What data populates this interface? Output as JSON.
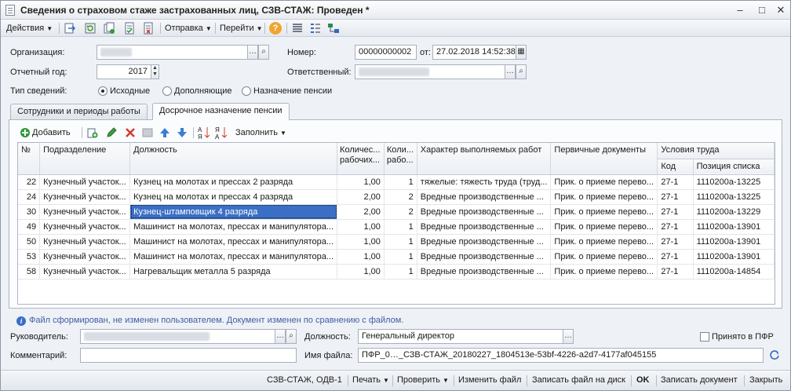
{
  "window": {
    "title": "Сведения о страховом стаже застрахованных лиц, СЗВ-СТАЖ: Проведен *",
    "minimize": "–",
    "maximize": "□",
    "close": "✕"
  },
  "toolbar": {
    "actions_label": "Действия",
    "send_label": "Отправка",
    "goto_label": "Перейти",
    "help_label": "?"
  },
  "form": {
    "organization_label": "Организация:",
    "organization_value": "",
    "number_label": "Номер:",
    "number_value": "00000000002",
    "date_label": "от:",
    "date_value": "27.02.2018 14:52:38",
    "year_label": "Отчетный год:",
    "year_value": "2017",
    "responsible_label": "Ответственный:",
    "responsible_value": "",
    "type_label": "Тип сведений:",
    "type_options": [
      "Исходные",
      "Дополняющие",
      "Назначение пенсии"
    ],
    "type_selected": "Исходные"
  },
  "tabs": [
    {
      "label": "Сотрудники и периоды работы"
    },
    {
      "label": "Досрочное назначение пенсии"
    }
  ],
  "grid_toolbar": {
    "add_label": "Добавить",
    "fill_label": "Заполнить"
  },
  "table": {
    "headers": {
      "num": "№",
      "dept": "Подразделение",
      "position": "Должность",
      "workers": "Количес... рабочих...",
      "places": "Коли... рабо...",
      "nature": "Характер выполняемых работ",
      "docs": "Первичные документы",
      "conditions": "Условия труда",
      "code": "Код",
      "list_pos": "Позиция списка"
    },
    "rows": [
      {
        "num": "22",
        "dept": "Кузнечный участок...",
        "position": "Кузнец на молотах и прессах 2 разряда",
        "workers": "1,00",
        "places": "1",
        "nature": "тяжелые: тяжесть труда (труд...",
        "docs": "Прик. о приеме перево...",
        "code": "27-1",
        "list_pos": "1110200а-13225"
      },
      {
        "num": "24",
        "dept": "Кузнечный участок...",
        "position": "Кузнец на молотах и прессах 4 разряда",
        "workers": "2,00",
        "places": "2",
        "nature": "Вредные производственные ...",
        "docs": "Прик. о приеме перево...",
        "code": "27-1",
        "list_pos": "1110200а-13225"
      },
      {
        "num": "30",
        "dept": "Кузнечный участок...",
        "position": "Кузнец-штамповщик 4 разряда",
        "workers": "2,00",
        "places": "2",
        "nature": "Вредные производственные ...",
        "docs": "Прик. о приеме перево...",
        "code": "27-1",
        "list_pos": "1110200а-13229"
      },
      {
        "num": "49",
        "dept": "Кузнечный участок...",
        "position": "Машинист на молотах, прессах и манипулятора...",
        "workers": "1,00",
        "places": "1",
        "nature": "Вредные производственные ...",
        "docs": "Прик. о приеме перево...",
        "code": "27-1",
        "list_pos": "1110200а-13901"
      },
      {
        "num": "50",
        "dept": "Кузнечный участок...",
        "position": "Машинист на молотах, прессах и манипулятора...",
        "workers": "1,00",
        "places": "1",
        "nature": "Вредные производственные ...",
        "docs": "Прик. о приеме перево...",
        "code": "27-1",
        "list_pos": "1110200а-13901"
      },
      {
        "num": "53",
        "dept": "Кузнечный участок...",
        "position": "Машинист на молотах, прессах и манипулятора...",
        "workers": "1,00",
        "places": "1",
        "nature": "Вредные производственные ...",
        "docs": "Прик. о приеме перево...",
        "code": "27-1",
        "list_pos": "1110200а-13901"
      },
      {
        "num": "58",
        "dept": "Кузнечный участок...",
        "position": "Нагревальщик металла 5 разряда",
        "workers": "1,00",
        "places": "1",
        "nature": "Вредные производственные ...",
        "docs": "Прик. о приеме перево...",
        "code": "27-1",
        "list_pos": "1110200а-14854"
      }
    ],
    "selected_row": 2
  },
  "footer": {
    "info_text": "Файл сформирован, не изменен пользователем. Документ изменен по сравнению с файлом.",
    "head_label": "Руководитель:",
    "head_value": "",
    "post_label": "Должность:",
    "post_value": "Генеральный директор",
    "accepted_label": "Принято в ПФР",
    "comment_label": "Комментарий:",
    "comment_value": "",
    "filename_label": "Имя файла:",
    "filename_value": "ПФР_0…_СЗВ-СТАЖ_20180227_1804513e-53bf-4226-a2d7-4177af045155"
  },
  "statusbar": {
    "form_name": "СЗВ-СТАЖ, ОДВ-1",
    "print_label": "Печать",
    "check_label": "Проверить",
    "edit_file_label": "Изменить файл",
    "write_file_label": "Записать файл на диск",
    "ok_label": "OK",
    "save_label": "Записать документ",
    "close_label": "Закрыть"
  },
  "colors": {
    "selection": "#3b6fc6",
    "info_text": "#3d5fa3",
    "delete_icon": "#d23a2a",
    "add_icon": "#2f9a3a"
  }
}
